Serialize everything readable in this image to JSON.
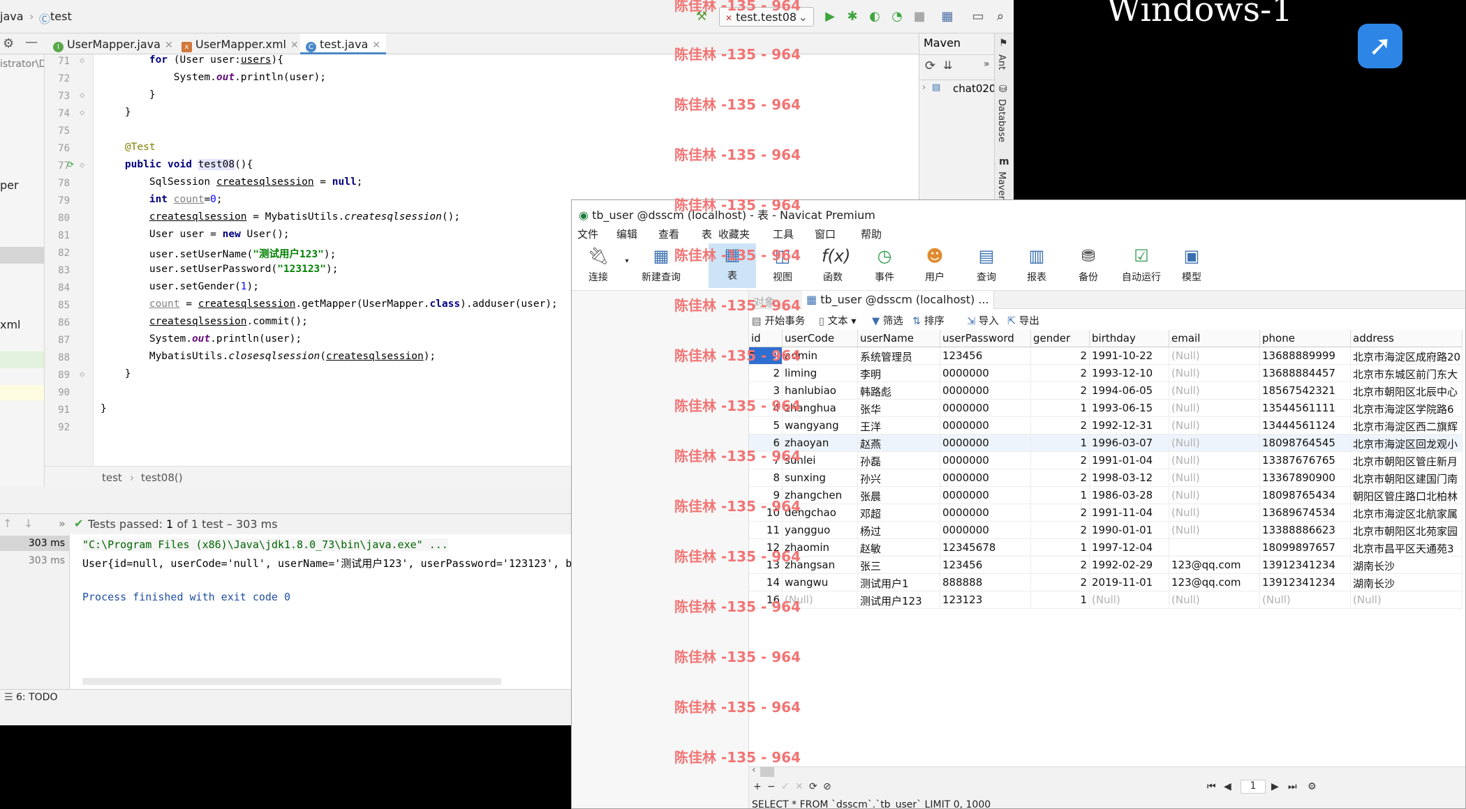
{
  "ide": {
    "breadcrumb": [
      "java",
      "test"
    ],
    "run_config": "test.test08",
    "tabs": [
      {
        "label": "UserMapper.java",
        "icon": "I",
        "active": false
      },
      {
        "label": "UserMapper.xml",
        "icon": "x",
        "active": false
      },
      {
        "label": "test.java",
        "icon": "C",
        "active": true
      }
    ],
    "project_fragments": [
      "istrator\\D",
      "per",
      "xml"
    ],
    "maven_label": "Maven",
    "maven_item": "chat020",
    "right_strip": [
      "Ant",
      "Database",
      "Maven"
    ],
    "code_breadcrumb": [
      "test",
      "test08()"
    ],
    "line_numbers": [
      "71",
      "72",
      "73",
      "74",
      "75",
      "76",
      "77",
      "78",
      "79",
      "80",
      "81",
      "82",
      "83",
      "84",
      "85",
      "86",
      "87",
      "88",
      "89",
      "90",
      "91",
      "92"
    ],
    "tests_status": "Tests passed:",
    "tests_count": "1",
    "tests_tail": "of 1 test – 303 ms",
    "run_times": [
      "303 ms",
      "303 ms"
    ],
    "run_output": [
      "\"C:\\Program Files (x86)\\Java\\jdk1.8.0_73\\bin\\java.exe\" ...",
      "User{id=null, userCode='null', userName='测试用户123', userPassword='123123', b",
      "",
      "Process finished with exit code 0"
    ],
    "todo_label": "6: TODO"
  },
  "windows_panel": {
    "title": "Windows-1"
  },
  "navicat": {
    "title": "tb_user @dsscm (localhost) - 表 - Navicat Premium",
    "menu": [
      "文件",
      "编辑",
      "查看",
      "表",
      "收藏夹",
      "工具",
      "窗口",
      "帮助"
    ],
    "tools": [
      "连接",
      "新建查询",
      "表",
      "视图",
      "函数",
      "事件",
      "用户",
      "查询",
      "报表",
      "备份",
      "自动运行",
      "模型"
    ],
    "object_tab": "tb_user @dsscm (localhost) ...",
    "object_tab_left": "对象",
    "obj_toolbar": [
      "开始事务",
      "文本",
      "筛选",
      "排序",
      "导入",
      "导出"
    ],
    "columns": [
      "id",
      "userCode",
      "userName",
      "userPassword",
      "gender",
      "birthday",
      "email",
      "phone",
      "address"
    ],
    "rows": [
      [
        "1",
        "admin",
        "系统管理员",
        "123456",
        "2",
        "1991-10-22",
        "(Null)",
        "13688889999",
        "北京市海淀区成府路20"
      ],
      [
        "2",
        "liming",
        "李明",
        "0000000",
        "2",
        "1993-12-10",
        "(Null)",
        "13688884457",
        "北京市东城区前门东大"
      ],
      [
        "3",
        "hanlubiao",
        "韩路彪",
        "0000000",
        "2",
        "1994-06-05",
        "(Null)",
        "18567542321",
        "北京市朝阳区北辰中心"
      ],
      [
        "4",
        "zhanghua",
        "张华",
        "0000000",
        "1",
        "1993-06-15",
        "(Null)",
        "13544561111",
        "北京市海淀区学院路6"
      ],
      [
        "5",
        "wangyang",
        "王洋",
        "0000000",
        "2",
        "1992-12-31",
        "(Null)",
        "13444561124",
        "北京市海淀区西二旗辉"
      ],
      [
        "6",
        "zhaoyan",
        "赵燕",
        "0000000",
        "1",
        "1996-03-07",
        "(Null)",
        "18098764545",
        "北京市海淀区回龙观小"
      ],
      [
        "7",
        "sunlei",
        "孙磊",
        "0000000",
        "2",
        "1991-01-04",
        "(Null)",
        "13387676765",
        "北京市朝阳区管庄新月"
      ],
      [
        "8",
        "sunxing",
        "孙兴",
        "0000000",
        "2",
        "1998-03-12",
        "(Null)",
        "13367890900",
        "北京市朝阳区建国门南"
      ],
      [
        "9",
        "zhangchen",
        "张晨",
        "0000000",
        "1",
        "1986-03-28",
        "(Null)",
        "18098765434",
        "朝阳区管庄路口北柏林"
      ],
      [
        "10",
        "dengchao",
        "邓超",
        "0000000",
        "2",
        "1991-11-04",
        "(Null)",
        "13689674534",
        "北京市海淀区北航家属"
      ],
      [
        "11",
        "yangguo",
        "杨过",
        "0000000",
        "2",
        "1990-01-01",
        "(Null)",
        "13388886623",
        "北京市朝阳区北苑家园"
      ],
      [
        "12",
        "zhaomin",
        "赵敏",
        "12345678",
        "1",
        "1997-12-04",
        "",
        "18099897657",
        "北京市昌平区天通苑3"
      ],
      [
        "13",
        "zhangsan",
        "张三",
        "123456",
        "2",
        "1992-02-29",
        "123@qq.com",
        "13912341234",
        "湖南长沙"
      ],
      [
        "14",
        "wangwu",
        "测试用户1",
        "888888",
        "2",
        "2019-11-01",
        "123@qq.com",
        "13912341234",
        "湖南长沙"
      ],
      [
        "16",
        "(Null)",
        "测试用户123",
        "123123",
        "1",
        "(Null)",
        "(Null)",
        "(Null)",
        "(Null)"
      ]
    ],
    "page_number": "1",
    "sql_status": "SELECT * FROM `dsscm`.`tb_user` LIMIT 0, 1000"
  },
  "watermark": "陈佳林 -135 - 964"
}
